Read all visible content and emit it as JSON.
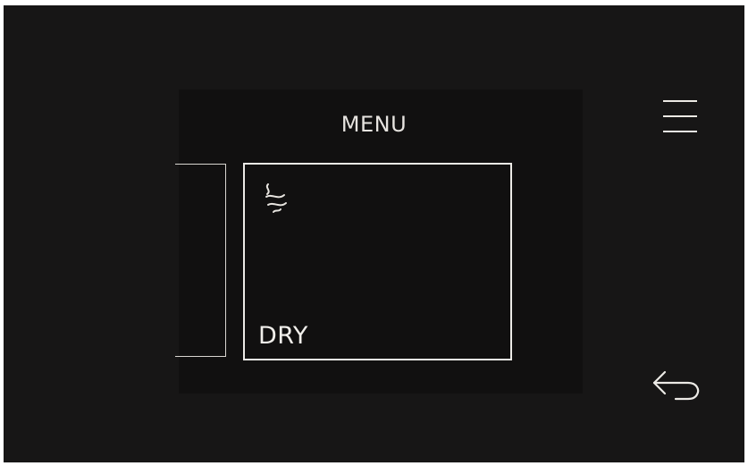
{
  "header": {
    "title": "MENU",
    "menu_icon": "hamburger-menu-icon"
  },
  "carousel": {
    "active_item": {
      "label": "DRY",
      "icon": "dry-waves-icon"
    }
  },
  "footer": {
    "back_icon": "back-arrow-icon"
  },
  "colors": {
    "background": "#171616",
    "panel": "#111010",
    "foreground": "#eceae6"
  }
}
